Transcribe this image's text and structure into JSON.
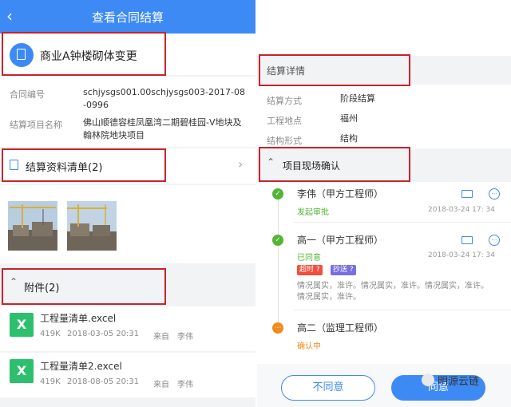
{
  "header": {
    "title": "查看合同结算"
  },
  "project": {
    "name": "商业A钟楼砌体变更"
  },
  "contract": {
    "no_label": "合同编号",
    "no_value": "schjysgs001.00schjysgs003-2017-08-0996",
    "item_label": "结算项目名称",
    "item_value": "佛山顺德容桂凤凰湾二期碧桂园-V地块及翰林院地块项目"
  },
  "materials": {
    "label": "结算资料清单(2)"
  },
  "attachments": {
    "label": "附件(2)",
    "files": [
      {
        "name": "工程量清单.excel",
        "size": "419K",
        "date": "2018-03-05 20:31",
        "from_label": "来自",
        "from": "李伟"
      },
      {
        "name": "工程量清单2.excel",
        "size": "419K",
        "date": "2018-08-05 20:31",
        "from_label": "来自",
        "from": "李伟"
      }
    ]
  },
  "details": {
    "title": "结算详情",
    "rows": [
      {
        "label": "结算方式",
        "value": "阶段结算"
      },
      {
        "label": "工程地点",
        "value": "福州"
      },
      {
        "label": "结构形式",
        "value": "结构"
      }
    ]
  },
  "site": {
    "title": "项目现场确认"
  },
  "timeline": [
    {
      "name": "李伟（甲方工程师）",
      "status": "发起审批",
      "time": "2018-03-24 17: 34",
      "status_color": "#52b534"
    },
    {
      "name": "高一（甲方工程师）",
      "status": "已同意",
      "time": "2018-03-24 17: 34",
      "status_color": "#52b534",
      "tags": [
        "超时",
        "抄送"
      ],
      "comment_line1": "情况属实，准许。情况属实，准许。情况属实，准许。",
      "comment_line2": "情况属实，准许。"
    },
    {
      "name": "高二（监理工程师）",
      "status": "确认中",
      "status_color": "#f08a1c"
    }
  ],
  "buttons": {
    "reject": "不同意",
    "agree": "同意"
  },
  "watermark": "明源云链",
  "colors": {
    "accent": "#3d8af5",
    "green": "#52b534",
    "orange": "#f08a1c",
    "red_box": "#c8232c"
  }
}
